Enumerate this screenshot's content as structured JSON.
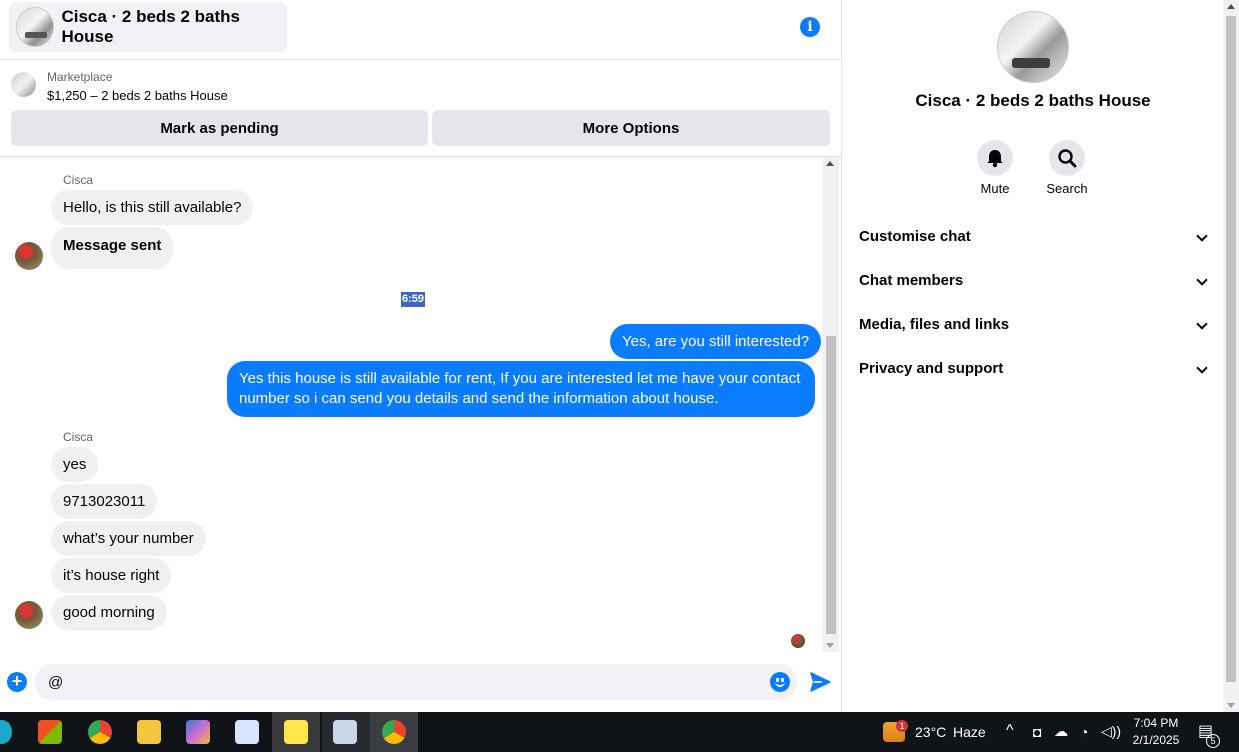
{
  "header": {
    "title": "Cisca · 2 beds 2 baths House",
    "info_icon": "info-icon"
  },
  "marketplace": {
    "label": "Marketplace",
    "listing": "$1,250 – 2 beds 2 baths House",
    "mark_pending": "Mark as pending",
    "more_options": "More Options"
  },
  "messages": {
    "sender_1": "Cisca",
    "in_1": "Hello, is this still available?",
    "in_2": "Message sent",
    "timestamp": "6:59",
    "out_1": "Yes, are you still interested?",
    "out_2": "Yes this house is still available for rent,  If you are interested  let me have your contact number so i can send you details and send the information about house.",
    "sender_2": "Cisca",
    "in_3": "yes",
    "in_4": "9713023011",
    "in_5": "what’s your number",
    "in_6": "it’s house right",
    "in_7": "good morning"
  },
  "composer": {
    "value": "@"
  },
  "details": {
    "title": "Cisca · 2 beds 2 baths House",
    "mute": "Mute",
    "search": "Search",
    "sections": [
      "Customise chat",
      "Chat members",
      "Media, files and links",
      "Privacy and support"
    ]
  },
  "taskbar": {
    "weather_badge": "1",
    "temperature": "23°C",
    "condition": "Haze",
    "time": "7:04 PM",
    "date": "2/1/2025",
    "notification_count": "5"
  },
  "colors": {
    "accent": "#0a7cff",
    "bubble_in": "#f0f0f0",
    "button_bg": "#e4e6eb",
    "taskbar": "#101317"
  }
}
